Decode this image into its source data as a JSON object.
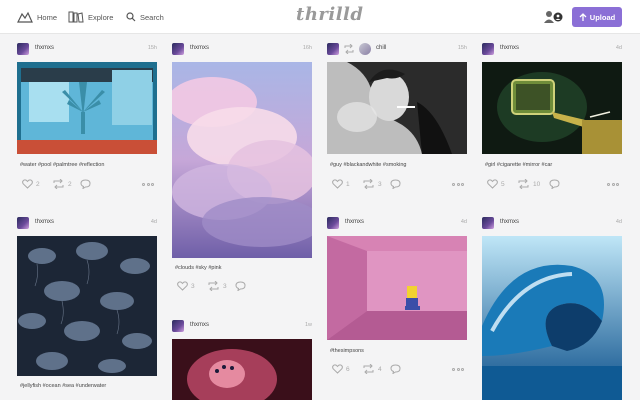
{
  "nav": {
    "home": "Home",
    "explore": "Explore",
    "search": "Search",
    "logo": "thrilld",
    "upload": "Upload"
  },
  "posts": [
    {
      "user": "thxmxs",
      "time": "15h",
      "tags": "#water #pool #palmtree #reflection",
      "likes": "2",
      "reposts": "2"
    },
    {
      "user": "thxmxs",
      "time": "16h",
      "tags": "#clouds #sky #pink",
      "likes": "3",
      "reposts": "3"
    },
    {
      "user": "chill",
      "time": "15h",
      "tags": "#guy #blackandwhite #smoking",
      "likes": "1",
      "reposts": "3"
    },
    {
      "user": "thxmxs",
      "time": "4d",
      "tags": "#girl #cigarette #mirror #car",
      "likes": "5",
      "reposts": "10"
    },
    {
      "user": "thxmxs",
      "time": "4d",
      "tags": "#jellyfish #ocean #sea #underwater"
    },
    {
      "user": "thxmxs",
      "time": "4d",
      "tags": "#thesimpsons",
      "likes": "6",
      "reposts": "4"
    },
    {
      "user": "thxmxs",
      "time": "1w"
    },
    {
      "user": "thxmxs",
      "time": "4d"
    }
  ],
  "icons": [
    "home-icon",
    "explore-icon",
    "search-icon",
    "user-icon",
    "upload-icon",
    "heart-icon",
    "repost-icon",
    "comment-icon",
    "more-icon"
  ],
  "colors": {
    "accent": "#8b6fd6",
    "background": "#f4f4f5",
    "topbar": "#ffffff"
  }
}
